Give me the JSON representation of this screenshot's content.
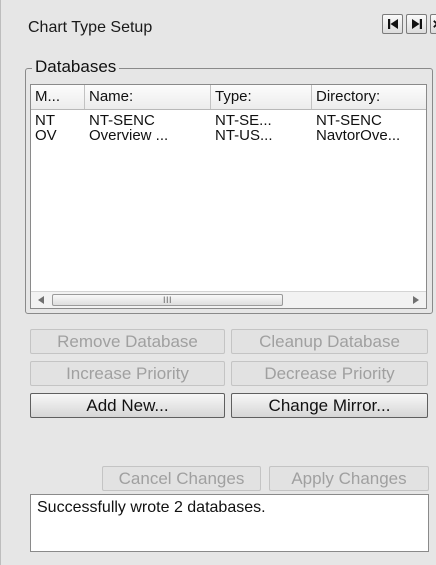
{
  "window": {
    "title": "Chart Type Setup",
    "nav_icons": [
      "skip-to-first-icon",
      "skip-to-last-icon",
      "close-icon"
    ]
  },
  "databases": {
    "legend": "Databases",
    "columns": [
      "M...",
      "Name:",
      "Type:",
      "Directory:"
    ],
    "rows": [
      [
        "NT",
        "NT-SENC",
        "NT-SE...",
        "NT-SENC"
      ],
      [
        "OV",
        "Overview ...",
        "NT-US...",
        "NavtorOve..."
      ]
    ],
    "scrollbar_grip": "III"
  },
  "buttons": {
    "remove_database": "Remove Database",
    "cleanup_database": "Cleanup Database",
    "increase_priority": "Increase Priority",
    "decrease_priority": "Decrease Priority",
    "add_new": "Add New...",
    "change_mirror": "Change Mirror...",
    "cancel_changes": "Cancel Changes",
    "apply_changes": "Apply Changes"
  },
  "status": {
    "message": "Successfully wrote 2 databases."
  },
  "colors": {
    "panel_background": "#e6e6e6",
    "disabled_text": "#a0a0a0"
  }
}
